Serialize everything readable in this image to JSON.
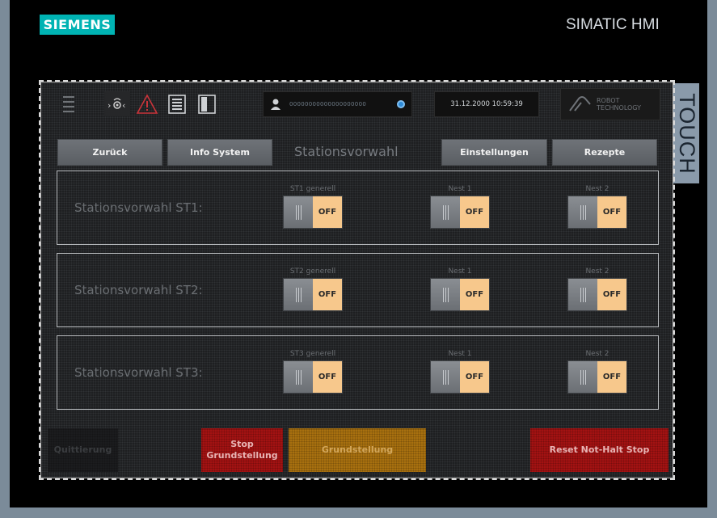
{
  "device": {
    "brand": "SIEMENS",
    "product": "SIMATIC HMI",
    "bezel_label": "TOUCH"
  },
  "topbar": {
    "user_id": "00000000000000000000",
    "datetime": "31.12.2000 10:59:39",
    "logo_line1": "ROBOT",
    "logo_line2": "TECHNOLOGY",
    "icons": [
      "menu-icon",
      "sensor-icon",
      "warning-icon",
      "list-icon",
      "door-icon",
      "user-icon",
      "settings-dot-icon"
    ]
  },
  "nav": {
    "back": "Zurück",
    "info": "Info System",
    "title": "Stationsvorwahl",
    "settings": "Einstellungen",
    "recipes": "Rezepte"
  },
  "stations": [
    {
      "label": "Stationsvorwahl ST1:",
      "switches": [
        {
          "caption": "ST1 generell",
          "state": "OFF"
        },
        {
          "caption": "Nest 1",
          "state": "OFF"
        },
        {
          "caption": "Nest 2",
          "state": "OFF"
        }
      ]
    },
    {
      "label": "Stationsvorwahl ST2:",
      "switches": [
        {
          "caption": "ST2 generell",
          "state": "OFF"
        },
        {
          "caption": "Nest 1",
          "state": "OFF"
        },
        {
          "caption": "Nest 2",
          "state": "OFF"
        }
      ]
    },
    {
      "label": "Stationsvorwahl ST3:",
      "switches": [
        {
          "caption": "ST3 generell",
          "state": "OFF"
        },
        {
          "caption": "Nest 1",
          "state": "OFF"
        },
        {
          "caption": "Nest 2",
          "state": "OFF"
        }
      ]
    }
  ],
  "bottom": {
    "acknowledge": "Quittierung",
    "stop_line1": "Stop",
    "stop_line2": "Grundstellung",
    "home": "Grundstellung",
    "reset": "Reset Not-Halt Stop"
  },
  "colors": {
    "switch_off": "#f7c88c",
    "stop_red": "#a31212",
    "home_amber": "#a8700f",
    "brand_teal": "#00b3b3"
  }
}
